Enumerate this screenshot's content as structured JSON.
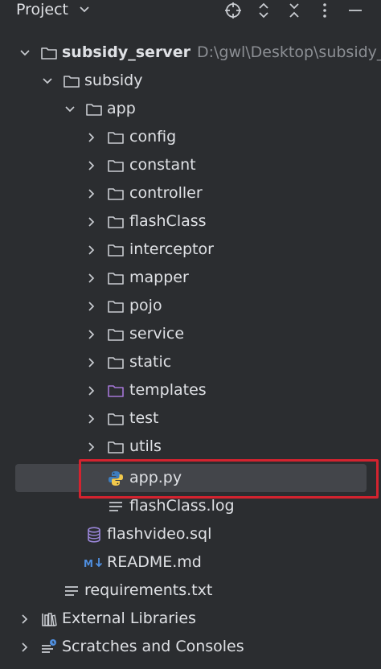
{
  "header": {
    "title": "Project"
  },
  "tree": {
    "root": {
      "name": "subsidy_server",
      "path": "D:\\gwl\\Desktop\\subsidy_m"
    },
    "subsidy": "subsidy",
    "app": "app",
    "folders": [
      "config",
      "constant",
      "controller",
      "flashClass",
      "interceptor",
      "mapper",
      "pojo",
      "service",
      "static",
      "templates",
      "test",
      "utils"
    ],
    "app_py": "app.py",
    "flash_log": "flashClass.log",
    "flashvideo_sql": "flashvideo.sql",
    "readme": "README.md",
    "requirements": "requirements.txt",
    "external_libraries": "External Libraries",
    "scratches": "Scratches and Consoles"
  },
  "colors": {
    "background": "#2b2d30",
    "selected": "#43454a",
    "highlight_border": "#d3232f",
    "python_blue": "#3d7dbf",
    "python_yellow": "#f2c94c",
    "md_blue": "#4f8fe0",
    "templates_folder": "#a476d6"
  }
}
